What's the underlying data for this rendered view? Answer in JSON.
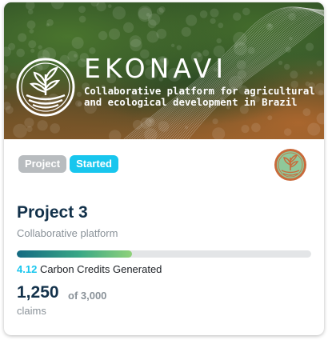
{
  "hero": {
    "title": "EKONAVI",
    "tagline": "Collaborative platform for agricultural\nand ecological development in Brazil",
    "logo_icon": "plant-in-circle-logo-icon"
  },
  "badges": {
    "type": "Project",
    "status": "Started"
  },
  "project": {
    "title": "Project 3",
    "subtitle": "Collaborative platform",
    "avatar_icon": "plant-avatar-icon"
  },
  "progress": {
    "fraction": 0.39
  },
  "credits": {
    "value": "4.12",
    "label": "Carbon Credits Generated"
  },
  "claims": {
    "count": "1,250",
    "total": "of 3,000",
    "label": "claims"
  },
  "colors": {
    "accent": "#18c6ee",
    "title_text": "#12314a",
    "muted_text": "#8a9299",
    "badge_gray": "#b8bcbf",
    "avatar_fill": "#8fc89a",
    "avatar_ring": "#c96a3b"
  }
}
